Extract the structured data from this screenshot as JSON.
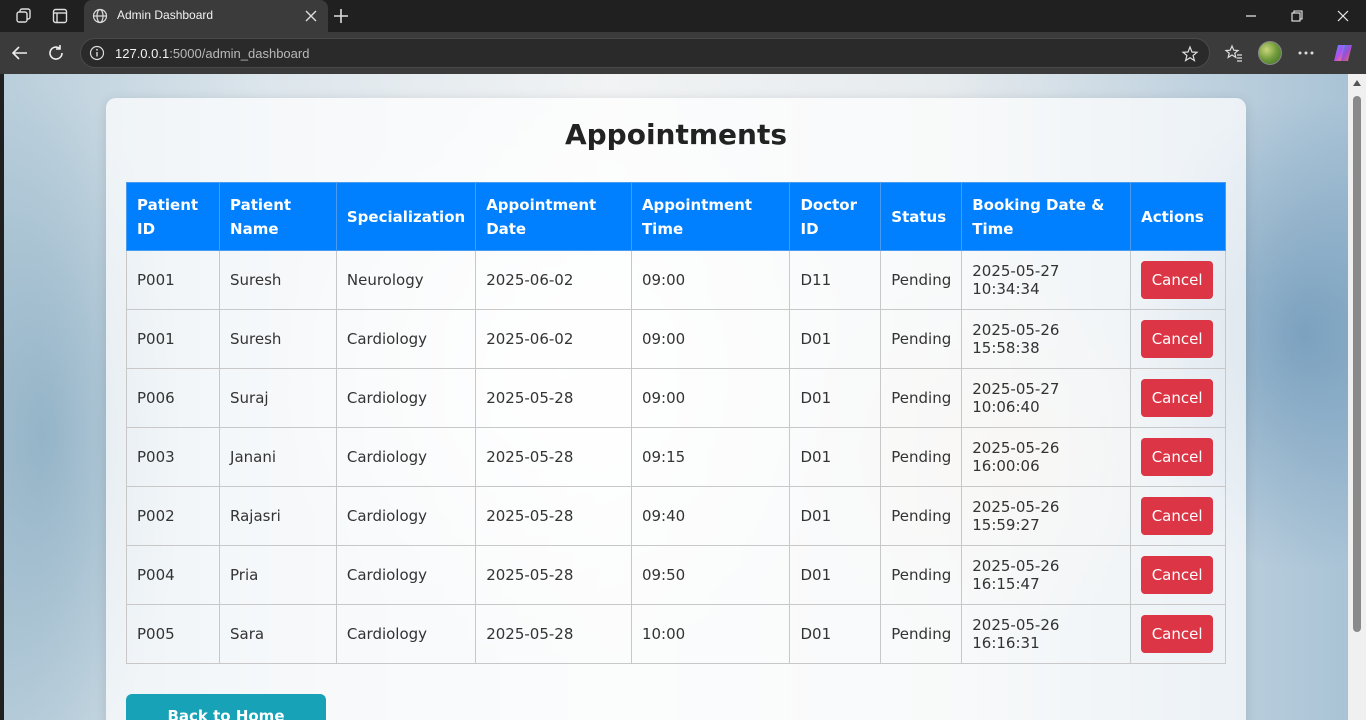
{
  "browser": {
    "tab_title": "Admin Dashboard",
    "url_host": "127.0.0.1",
    "url_rest": ":5000/admin_dashboard"
  },
  "page": {
    "title": "Appointments",
    "back_button": "Back to Home",
    "columns": [
      "Patient ID",
      "Patient Name",
      "Specialization",
      "Appointment Date",
      "Appointment Time",
      "Doctor ID",
      "Status",
      "Booking Date & Time",
      "Actions"
    ],
    "rows": [
      {
        "patient_id": "P001",
        "patient_name": "Suresh",
        "specialization": "Neurology",
        "date": "2025-06-02",
        "time": "09:00",
        "doctor_id": "D11",
        "status": "Pending",
        "booked": "2025-05-27 10:34:34",
        "action": "Cancel"
      },
      {
        "patient_id": "P001",
        "patient_name": "Suresh",
        "specialization": "Cardiology",
        "date": "2025-06-02",
        "time": "09:00",
        "doctor_id": "D01",
        "status": "Pending",
        "booked": "2025-05-26 15:58:38",
        "action": "Cancel"
      },
      {
        "patient_id": "P006",
        "patient_name": "Suraj",
        "specialization": "Cardiology",
        "date": "2025-05-28",
        "time": "09:00",
        "doctor_id": "D01",
        "status": "Pending",
        "booked": "2025-05-27 10:06:40",
        "action": "Cancel"
      },
      {
        "patient_id": "P003",
        "patient_name": "Janani",
        "specialization": "Cardiology",
        "date": "2025-05-28",
        "time": "09:15",
        "doctor_id": "D01",
        "status": "Pending",
        "booked": "2025-05-26 16:00:06",
        "action": "Cancel"
      },
      {
        "patient_id": "P002",
        "patient_name": "Rajasri",
        "specialization": "Cardiology",
        "date": "2025-05-28",
        "time": "09:40",
        "doctor_id": "D01",
        "status": "Pending",
        "booked": "2025-05-26 15:59:27",
        "action": "Cancel"
      },
      {
        "patient_id": "P004",
        "patient_name": "Pria",
        "specialization": "Cardiology",
        "date": "2025-05-28",
        "time": "09:50",
        "doctor_id": "D01",
        "status": "Pending",
        "booked": "2025-05-26 16:15:47",
        "action": "Cancel"
      },
      {
        "patient_id": "P005",
        "patient_name": "Sara",
        "specialization": "Cardiology",
        "date": "2025-05-28",
        "time": "10:00",
        "doctor_id": "D01",
        "status": "Pending",
        "booked": "2025-05-26 16:16:31",
        "action": "Cancel"
      }
    ]
  },
  "colors": {
    "header_blue": "#0080ff",
    "cancel_red": "#dc3545",
    "back_teal": "#17a2b8"
  }
}
